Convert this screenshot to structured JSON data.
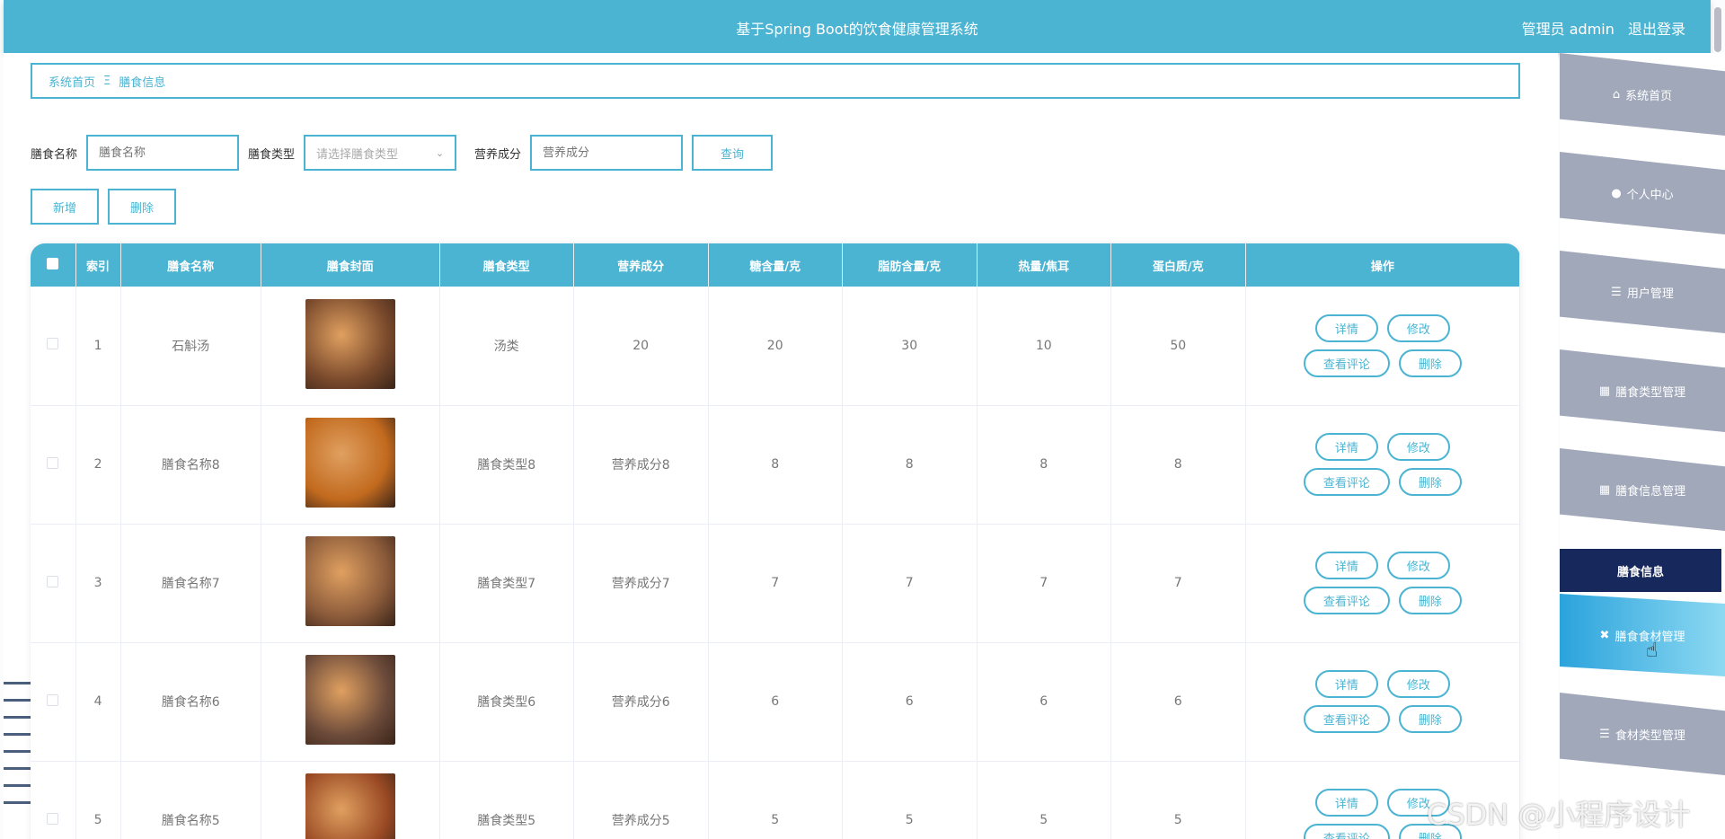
{
  "header": {
    "title": "基于Spring Boot的饮食健康管理系统",
    "role": "管理员 admin",
    "logout": "退出登录"
  },
  "breadcrumb": {
    "home": "系统首页",
    "sep": "Ξ",
    "current": "膳食信息"
  },
  "search": {
    "name_label": "膳食名称",
    "name_placeholder": "膳食名称",
    "type_label": "膳食类型",
    "type_placeholder": "请选择膳食类型",
    "nutrition_label": "营养成分",
    "nutrition_placeholder": "营养成分",
    "query_button": "查询"
  },
  "actions": {
    "add": "新增",
    "delete": "删除"
  },
  "table": {
    "columns": [
      "索引",
      "膳食名称",
      "膳食封面",
      "膳食类型",
      "营养成分",
      "糖含量/克",
      "脂肪含量/克",
      "热量/焦耳",
      "蛋白质/克",
      "操作"
    ],
    "row_buttons": {
      "detail": "详情",
      "edit": "修改",
      "reviews": "查看评论",
      "delete": "删除"
    },
    "rows": [
      {
        "index": "1",
        "name": "石斛汤",
        "type": "汤类",
        "nutrition": "20",
        "sugar": "20",
        "fat": "30",
        "calories": "10",
        "protein": "50",
        "cover_color": "#7a4a2c"
      },
      {
        "index": "2",
        "name": "膳食名称8",
        "type": "膳食类型8",
        "nutrition": "营养成分8",
        "sugar": "8",
        "fat": "8",
        "calories": "8",
        "protein": "8",
        "cover_color": "#c26a1e"
      },
      {
        "index": "3",
        "name": "膳食名称7",
        "type": "膳食类型7",
        "nutrition": "营养成分7",
        "sugar": "7",
        "fat": "7",
        "calories": "7",
        "protein": "7",
        "cover_color": "#8a5a3a"
      },
      {
        "index": "4",
        "name": "膳食名称6",
        "type": "膳食类型6",
        "nutrition": "营养成分6",
        "sugar": "6",
        "fat": "6",
        "calories": "6",
        "protein": "6",
        "cover_color": "#6b4a3a"
      },
      {
        "index": "5",
        "name": "膳食名称5",
        "type": "膳食类型5",
        "nutrition": "营养成分5",
        "sugar": "5",
        "fat": "5",
        "calories": "5",
        "protein": "5",
        "cover_color": "#9a4a24"
      }
    ]
  },
  "sidebar": {
    "items": [
      {
        "label": "系统首页",
        "icon": "home-icon"
      },
      {
        "label": "个人中心",
        "icon": "user-icon"
      },
      {
        "label": "用户管理",
        "icon": "list-icon"
      },
      {
        "label": "膳食类型管理",
        "icon": "grid-icon"
      },
      {
        "label": "膳食信息管理",
        "icon": "grid-icon"
      },
      {
        "label": "膳食食材管理",
        "icon": "ingredient-icon"
      },
      {
        "label": "食材类型管理",
        "icon": "list-icon"
      }
    ],
    "submenu": "膳食信息"
  },
  "watermark": "CSDN @小程序设计",
  "colors": {
    "accent": "#4bb4d2",
    "sidebar_item": "#a0a8ba",
    "submenu": "#17285c"
  }
}
